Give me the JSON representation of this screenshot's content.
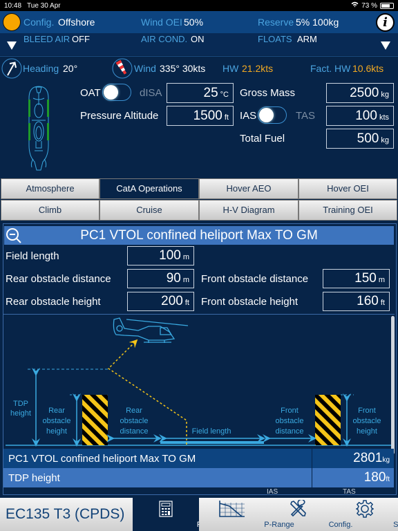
{
  "status_bar": {
    "time": "10:48",
    "date": "Tue 30 Apr",
    "battery": "73 %"
  },
  "config_bar": {
    "config": {
      "label": "Config.",
      "value": "Offshore"
    },
    "wind_oei": {
      "label": "Wind OEI",
      "value": "50%"
    },
    "reserve": {
      "label": "Reserve",
      "value": "5% 100kg"
    },
    "bleed_air": {
      "label": "BLEED AIR",
      "value": "OFF"
    },
    "air_cond": {
      "label": "AIR COND.",
      "value": "ON"
    },
    "floats": {
      "label": "FLOATS",
      "value": "ARM"
    },
    "info_glyph": "i"
  },
  "wind_bar": {
    "heading": {
      "label": "Heading",
      "value": "20°"
    },
    "wind": {
      "label": "Wind",
      "value": "335° 30kts"
    },
    "hw": {
      "label": "HW",
      "value": "21.2kts"
    },
    "fact_hw": {
      "label": "Fact. HW",
      "value": "10.6kts"
    }
  },
  "inputs": {
    "oat_toggle": {
      "left": "OAT",
      "right": "dISA",
      "state": "OAT"
    },
    "oat": {
      "value": "25",
      "unit": "°C"
    },
    "pressure_altitude": {
      "label": "Pressure Altitude",
      "value": "1500",
      "unit": "ft"
    },
    "gross_mass": {
      "label": "Gross Mass",
      "value": "2500",
      "unit": "kg"
    },
    "speed_toggle": {
      "left": "IAS",
      "right": "TAS",
      "state": "IAS"
    },
    "speed": {
      "value": "100",
      "unit": "kts"
    },
    "total_fuel": {
      "label": "Total Fuel",
      "value": "500",
      "unit": "kg"
    }
  },
  "tabs": [
    {
      "label": "Atmosphere",
      "active": false
    },
    {
      "label": "CatA Operations",
      "active": true
    },
    {
      "label": "Hover AEO",
      "active": false
    },
    {
      "label": "Hover OEI",
      "active": false
    },
    {
      "label": "Climb",
      "active": false
    },
    {
      "label": "Cruise",
      "active": false
    },
    {
      "label": "H-V Diagram",
      "active": false
    },
    {
      "label": "Training OEI",
      "active": false
    }
  ],
  "panel": {
    "title": "PC1 VTOL confined heliport Max TO GM",
    "field_length": {
      "label": "Field length",
      "value": "100",
      "unit": "m"
    },
    "rear_obstacle_distance": {
      "label": "Rear obstacle distance",
      "value": "90",
      "unit": "m"
    },
    "front_obstacle_distance": {
      "label": "Front obstacle distance",
      "value": "150",
      "unit": "m"
    },
    "rear_obstacle_height": {
      "label": "Rear obstacle height",
      "value": "200",
      "unit": "ft"
    },
    "front_obstacle_height": {
      "label": "Front obstacle height",
      "value": "160",
      "unit": "ft"
    }
  },
  "diagram": {
    "tdp_height": [
      "TDP",
      "height"
    ],
    "rear_obstacle_height": [
      "Rear",
      "obstacle",
      "height"
    ],
    "rear_obstacle_distance": [
      "Rear",
      "obstacle",
      "distance"
    ],
    "field_length": "Field length",
    "front_obstacle_distance": [
      "Front",
      "obstacle",
      "distance"
    ],
    "front_obstacle_height": [
      "Front",
      "obstacle",
      "height"
    ]
  },
  "results": [
    {
      "label": "PC1 VTOL confined heliport Max TO GM",
      "value": "2801",
      "unit": "kg"
    },
    {
      "label": "TDP height",
      "value": "180",
      "unit": "ft"
    }
  ],
  "results_footer": {
    "ias": "IAS",
    "tas": "TAS"
  },
  "bottom_bar": {
    "aircraft": "EC135 T3 (CPDS)",
    "items": [
      {
        "label": "Perfo",
        "active": true
      },
      {
        "label": "P-Range",
        "active": false
      },
      {
        "label": "Config.",
        "active": false
      },
      {
        "label": "Settings",
        "active": false
      }
    ]
  }
}
